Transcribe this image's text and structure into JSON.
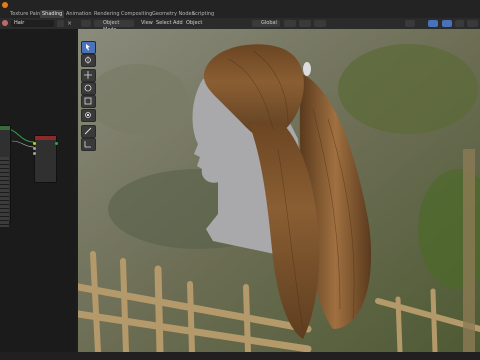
{
  "app": {
    "icon": "blender-logo-icon"
  },
  "tabs": [
    {
      "label": "Texture Paint",
      "active": false
    },
    {
      "label": "Shading",
      "active": true
    },
    {
      "label": "Animation",
      "active": false
    },
    {
      "label": "Rendering",
      "active": false
    },
    {
      "label": "Compositing",
      "active": false
    },
    {
      "label": "Geometry Nodes",
      "active": false
    },
    {
      "label": "Scripting",
      "active": false
    }
  ],
  "node_editor": {
    "object_name": "Hair"
  },
  "viewport_header": {
    "mode": "Object Mode",
    "menus": [
      "View",
      "Select",
      "Add",
      "Object"
    ],
    "transform_orientation": "Global"
  },
  "toolbar": {
    "tools": [
      "select-box-icon",
      "cursor-icon",
      "move-icon",
      "rotate-icon",
      "scale-icon",
      "transform-icon",
      "annotate-icon",
      "measure-icon"
    ]
  },
  "colors": {
    "accent": "#4a72b8",
    "panel": "#2b2b2b",
    "node_header": "#8b2a2a",
    "hair": "#7a5330"
  }
}
